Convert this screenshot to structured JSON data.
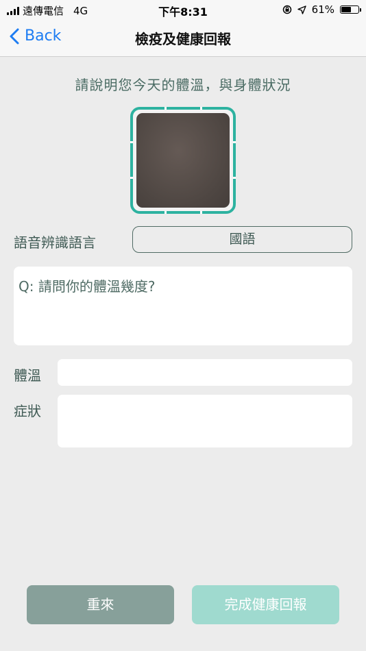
{
  "status_bar": {
    "carrier": "遠傳電信",
    "network": "4G",
    "time": "下午8:31",
    "battery": "61%",
    "battery_level": 0.61
  },
  "nav": {
    "back_label": "Back",
    "title": "檢疫及健康回報"
  },
  "instruction": "請說明您今天的體溫，與身體狀況",
  "language": {
    "label": "語音辨識語言",
    "selected": "國語"
  },
  "question": "Q: 請問你的體溫幾度?",
  "fields": {
    "temperature_label": "體溫",
    "temperature_value": "",
    "symptoms_label": "症狀",
    "symptoms_value": ""
  },
  "buttons": {
    "retry": "重來",
    "done": "完成健康回報"
  },
  "colors": {
    "accent": "#2db2a0",
    "link": "#1d7cf2",
    "retry_bg": "#87a09a",
    "done_bg": "#9fdacf"
  }
}
